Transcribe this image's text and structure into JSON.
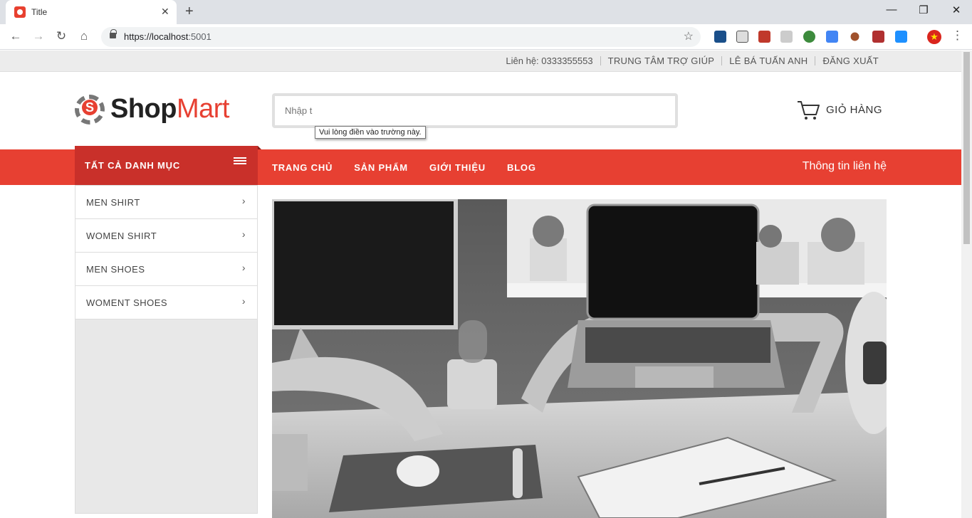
{
  "browser": {
    "tab_title": "Title",
    "url_host": "https://localhost",
    "url_port": ":5001"
  },
  "topbar": {
    "contact": "Liên hệ: 0333355553",
    "help": "TRUNG TÂM TRỢ GIÚP",
    "user": "LÊ BÁ TUẤN ANH",
    "logout": "ĐĂNG XUẤT"
  },
  "header": {
    "logo_part1": "Shop",
    "logo_part2": "Mart",
    "search_placeholder": "Nhập t",
    "validation_tooltip": "Vui lòng điền vào trường này.",
    "cart_label": "GIỎ HÀNG"
  },
  "nav": {
    "all_categories": "TẤT CẢ DANH MỤC",
    "links": [
      "TRANG CHỦ",
      "SẢN PHẨM",
      "GIỚI THIỆU",
      "BLOG"
    ],
    "contact": "Thông tin liên hệ"
  },
  "categories": [
    "MEN SHIRT",
    "WOMEN SHIRT",
    "MEN SHOES",
    "WOMENT SHOES"
  ],
  "colors": {
    "brand_red": "#e74032",
    "brand_red_dark": "#c9302a"
  }
}
